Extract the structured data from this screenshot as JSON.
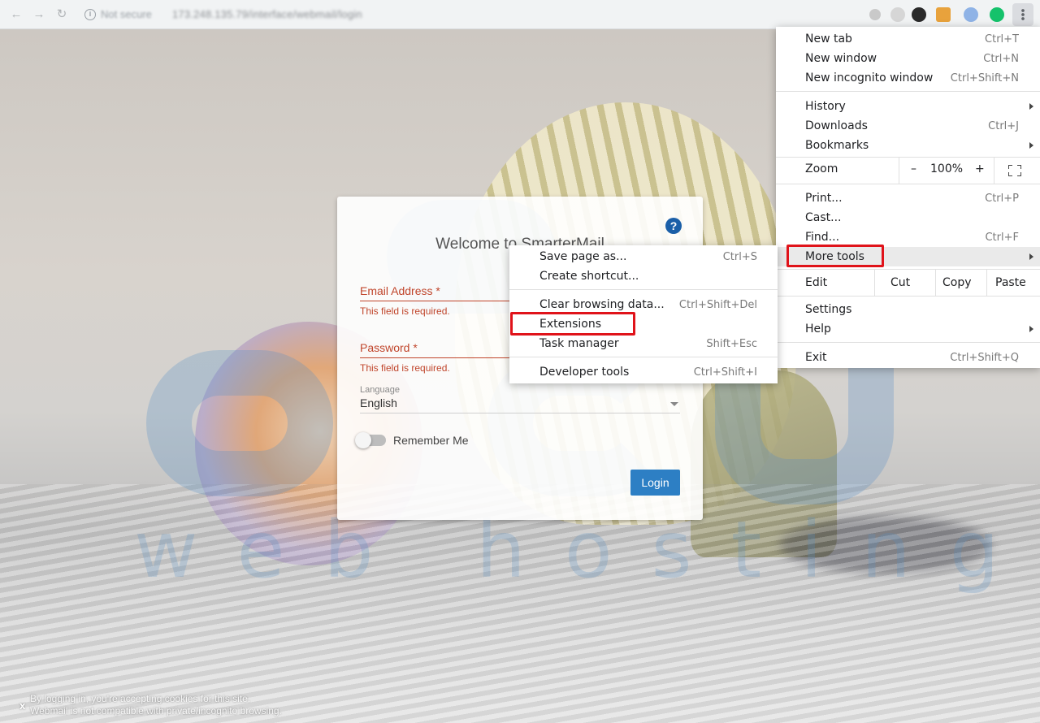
{
  "browser": {
    "security_label": "Not secure",
    "url": "173.248.135.79/interface/webmail/login"
  },
  "watermark": {
    "brand_letters": "acu",
    "tagline": "web hosting"
  },
  "login": {
    "welcome": "Welcome to SmarterMail",
    "email_label": "Email Address *",
    "email_error": "This field is required.",
    "password_label": "Password *",
    "password_error": "This field is required.",
    "language_label": "Language",
    "language_value": "English",
    "remember_label": "Remember Me",
    "login_button": "Login"
  },
  "footer": {
    "close": "x",
    "line1": "By logging in, you're accepting cookies for this site.",
    "line2": "Webmail is not compatible with private/incognito browsing."
  },
  "main_menu": {
    "new_tab": "New tab",
    "new_tab_sc": "Ctrl+T",
    "new_window": "New window",
    "new_window_sc": "Ctrl+N",
    "new_incognito": "New incognito window",
    "new_incognito_sc": "Ctrl+Shift+N",
    "history": "History",
    "downloads": "Downloads",
    "downloads_sc": "Ctrl+J",
    "bookmarks": "Bookmarks",
    "zoom": "Zoom",
    "zoom_minus": "–",
    "zoom_level": "100%",
    "zoom_plus": "+",
    "print": "Print...",
    "print_sc": "Ctrl+P",
    "cast": "Cast...",
    "find": "Find...",
    "find_sc": "Ctrl+F",
    "more_tools": "More tools",
    "edit": "Edit",
    "cut": "Cut",
    "copy": "Copy",
    "paste": "Paste",
    "settings": "Settings",
    "help": "Help",
    "exit": "Exit",
    "exit_sc": "Ctrl+Shift+Q"
  },
  "sub_menu": {
    "save_page": "Save page as...",
    "save_page_sc": "Ctrl+S",
    "create_shortcut": "Create shortcut...",
    "clear_data": "Clear browsing data...",
    "clear_data_sc": "Ctrl+Shift+Del",
    "extensions": "Extensions",
    "task_manager": "Task manager",
    "task_manager_sc": "Shift+Esc",
    "dev_tools": "Developer tools",
    "dev_tools_sc": "Ctrl+Shift+I"
  },
  "colors": {
    "annotation_red": "#e0131a",
    "login_blue": "#2d7fc4",
    "error_red": "#c0452b"
  }
}
